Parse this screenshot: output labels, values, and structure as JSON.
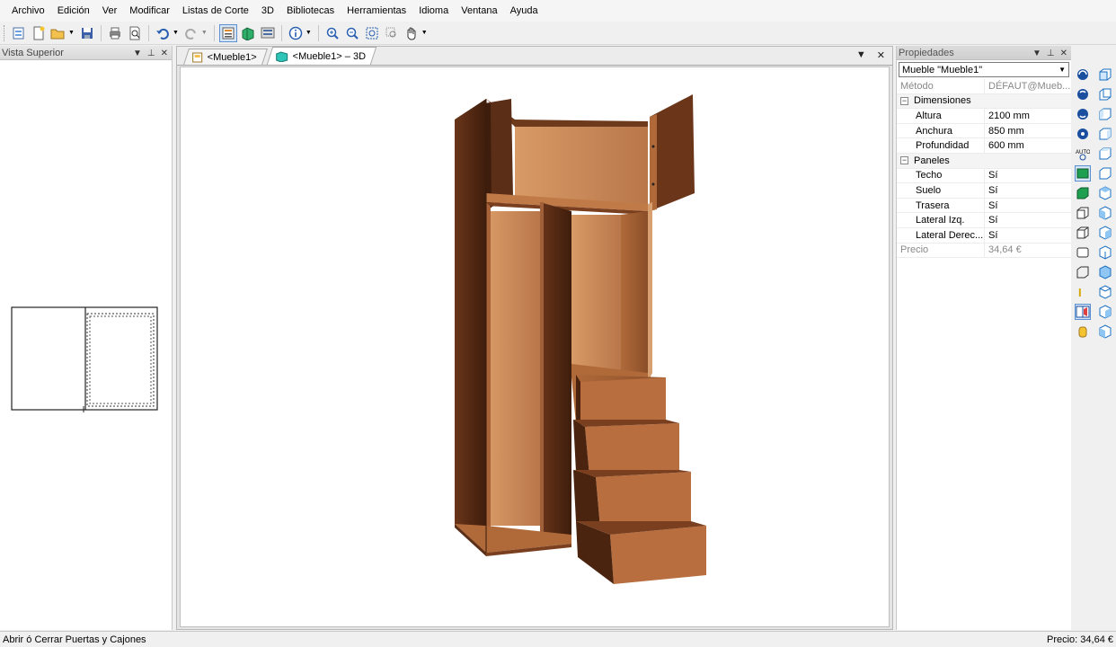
{
  "menu": [
    "Archivo",
    "Edición",
    "Ver",
    "Modificar",
    "Listas de Corte",
    "3D",
    "Bibliotecas",
    "Herramientas",
    "Idioma",
    "Ventana",
    "Ayuda"
  ],
  "left_panel": {
    "title": "Vista Superior"
  },
  "tabs": [
    {
      "label": "<Mueble1>"
    },
    {
      "label": "<Mueble1> – 3D"
    }
  ],
  "properties": {
    "title": "Propiedades",
    "object": "Mueble \"Mueble1\"",
    "metodo": {
      "label": "Método",
      "value": "DÉFAUT@Mueb..."
    },
    "dimensiones": {
      "label": "Dimensiones",
      "rows": [
        {
          "label": "Altura",
          "value": "2100 mm"
        },
        {
          "label": "Anchura",
          "value": "850 mm"
        },
        {
          "label": "Profundidad",
          "value": "600 mm"
        }
      ]
    },
    "paneles": {
      "label": "Paneles",
      "rows": [
        {
          "label": "Techo",
          "value": "Sí"
        },
        {
          "label": "Suelo",
          "value": "Sí"
        },
        {
          "label": "Trasera",
          "value": "Sí"
        },
        {
          "label": "Lateral Izq.",
          "value": "Sí"
        },
        {
          "label": "Lateral Derec...",
          "value": "Sí"
        }
      ]
    },
    "precio": {
      "label": "Precio",
      "value": "34,64 €"
    }
  },
  "status": {
    "left": "Abrir ó Cerrar Puertas y Cajones",
    "right": "Precio: 34,64 €"
  },
  "colors": {
    "wood_light": "#c98a57",
    "wood_dark": "#5a2e17",
    "accent": "#5a8fd0"
  }
}
